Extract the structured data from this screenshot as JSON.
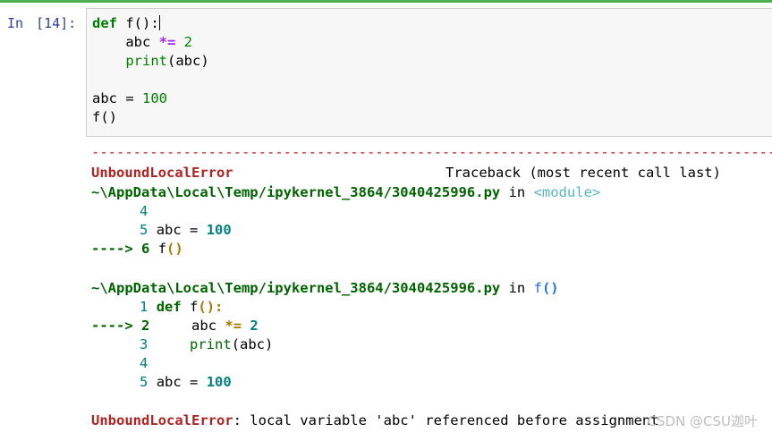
{
  "cell": {
    "prompt_label": "In",
    "prompt_number": "[14]:",
    "code": {
      "l1_kw": "def",
      "l1_rest": " f():",
      "l2_indent": "    abc ",
      "l2_op": "*=",
      "l2_num": " 2",
      "l3_indent": "    ",
      "l3_bi": "print",
      "l3_rest": "(abc)",
      "l5_var": "abc",
      "l5_eq": " = ",
      "l5_num": "100",
      "l6": "f()"
    }
  },
  "output": {
    "dashes": "-----------------------------------------------------------------------------------",
    "error_name": "UnboundLocalError",
    "traceback_label": "Traceback (most recent call last)",
    "frame1": {
      "path": "~\\AppData\\Local\\Temp/ipykernel_3864/3040425996.py",
      "in_word": " in ",
      "module": "<module>",
      "lines": [
        {
          "num": "4",
          "code": ""
        },
        {
          "num": "5",
          "code_var": "abc",
          "code_eq": " = ",
          "code_num": "100"
        },
        {
          "arrow": "---->",
          "num": "6",
          "code_name": "f",
          "code_paren": "()"
        }
      ]
    },
    "frame2": {
      "path": "~\\AppData\\Local\\Temp/ipykernel_3864/3040425996.py",
      "in_word": " in ",
      "func_name": "f",
      "func_paren": "()",
      "lines": [
        {
          "num": "1",
          "kw": "def",
          "name": " f",
          "paren": "():"
        },
        {
          "arrow": "---->",
          "num": "2",
          "var": "abc",
          "op": "*=",
          "val": "2"
        },
        {
          "num": "3",
          "bi": "print",
          "rest": "(abc)"
        },
        {
          "num": "4"
        },
        {
          "num": "5",
          "var": "abc",
          "eq": " = ",
          "val": "100"
        }
      ]
    },
    "final_error": {
      "name": "UnboundLocalError",
      "message": ": local variable 'abc' referenced before assignment"
    }
  },
  "watermark": "CSDN @CSU迦叶"
}
